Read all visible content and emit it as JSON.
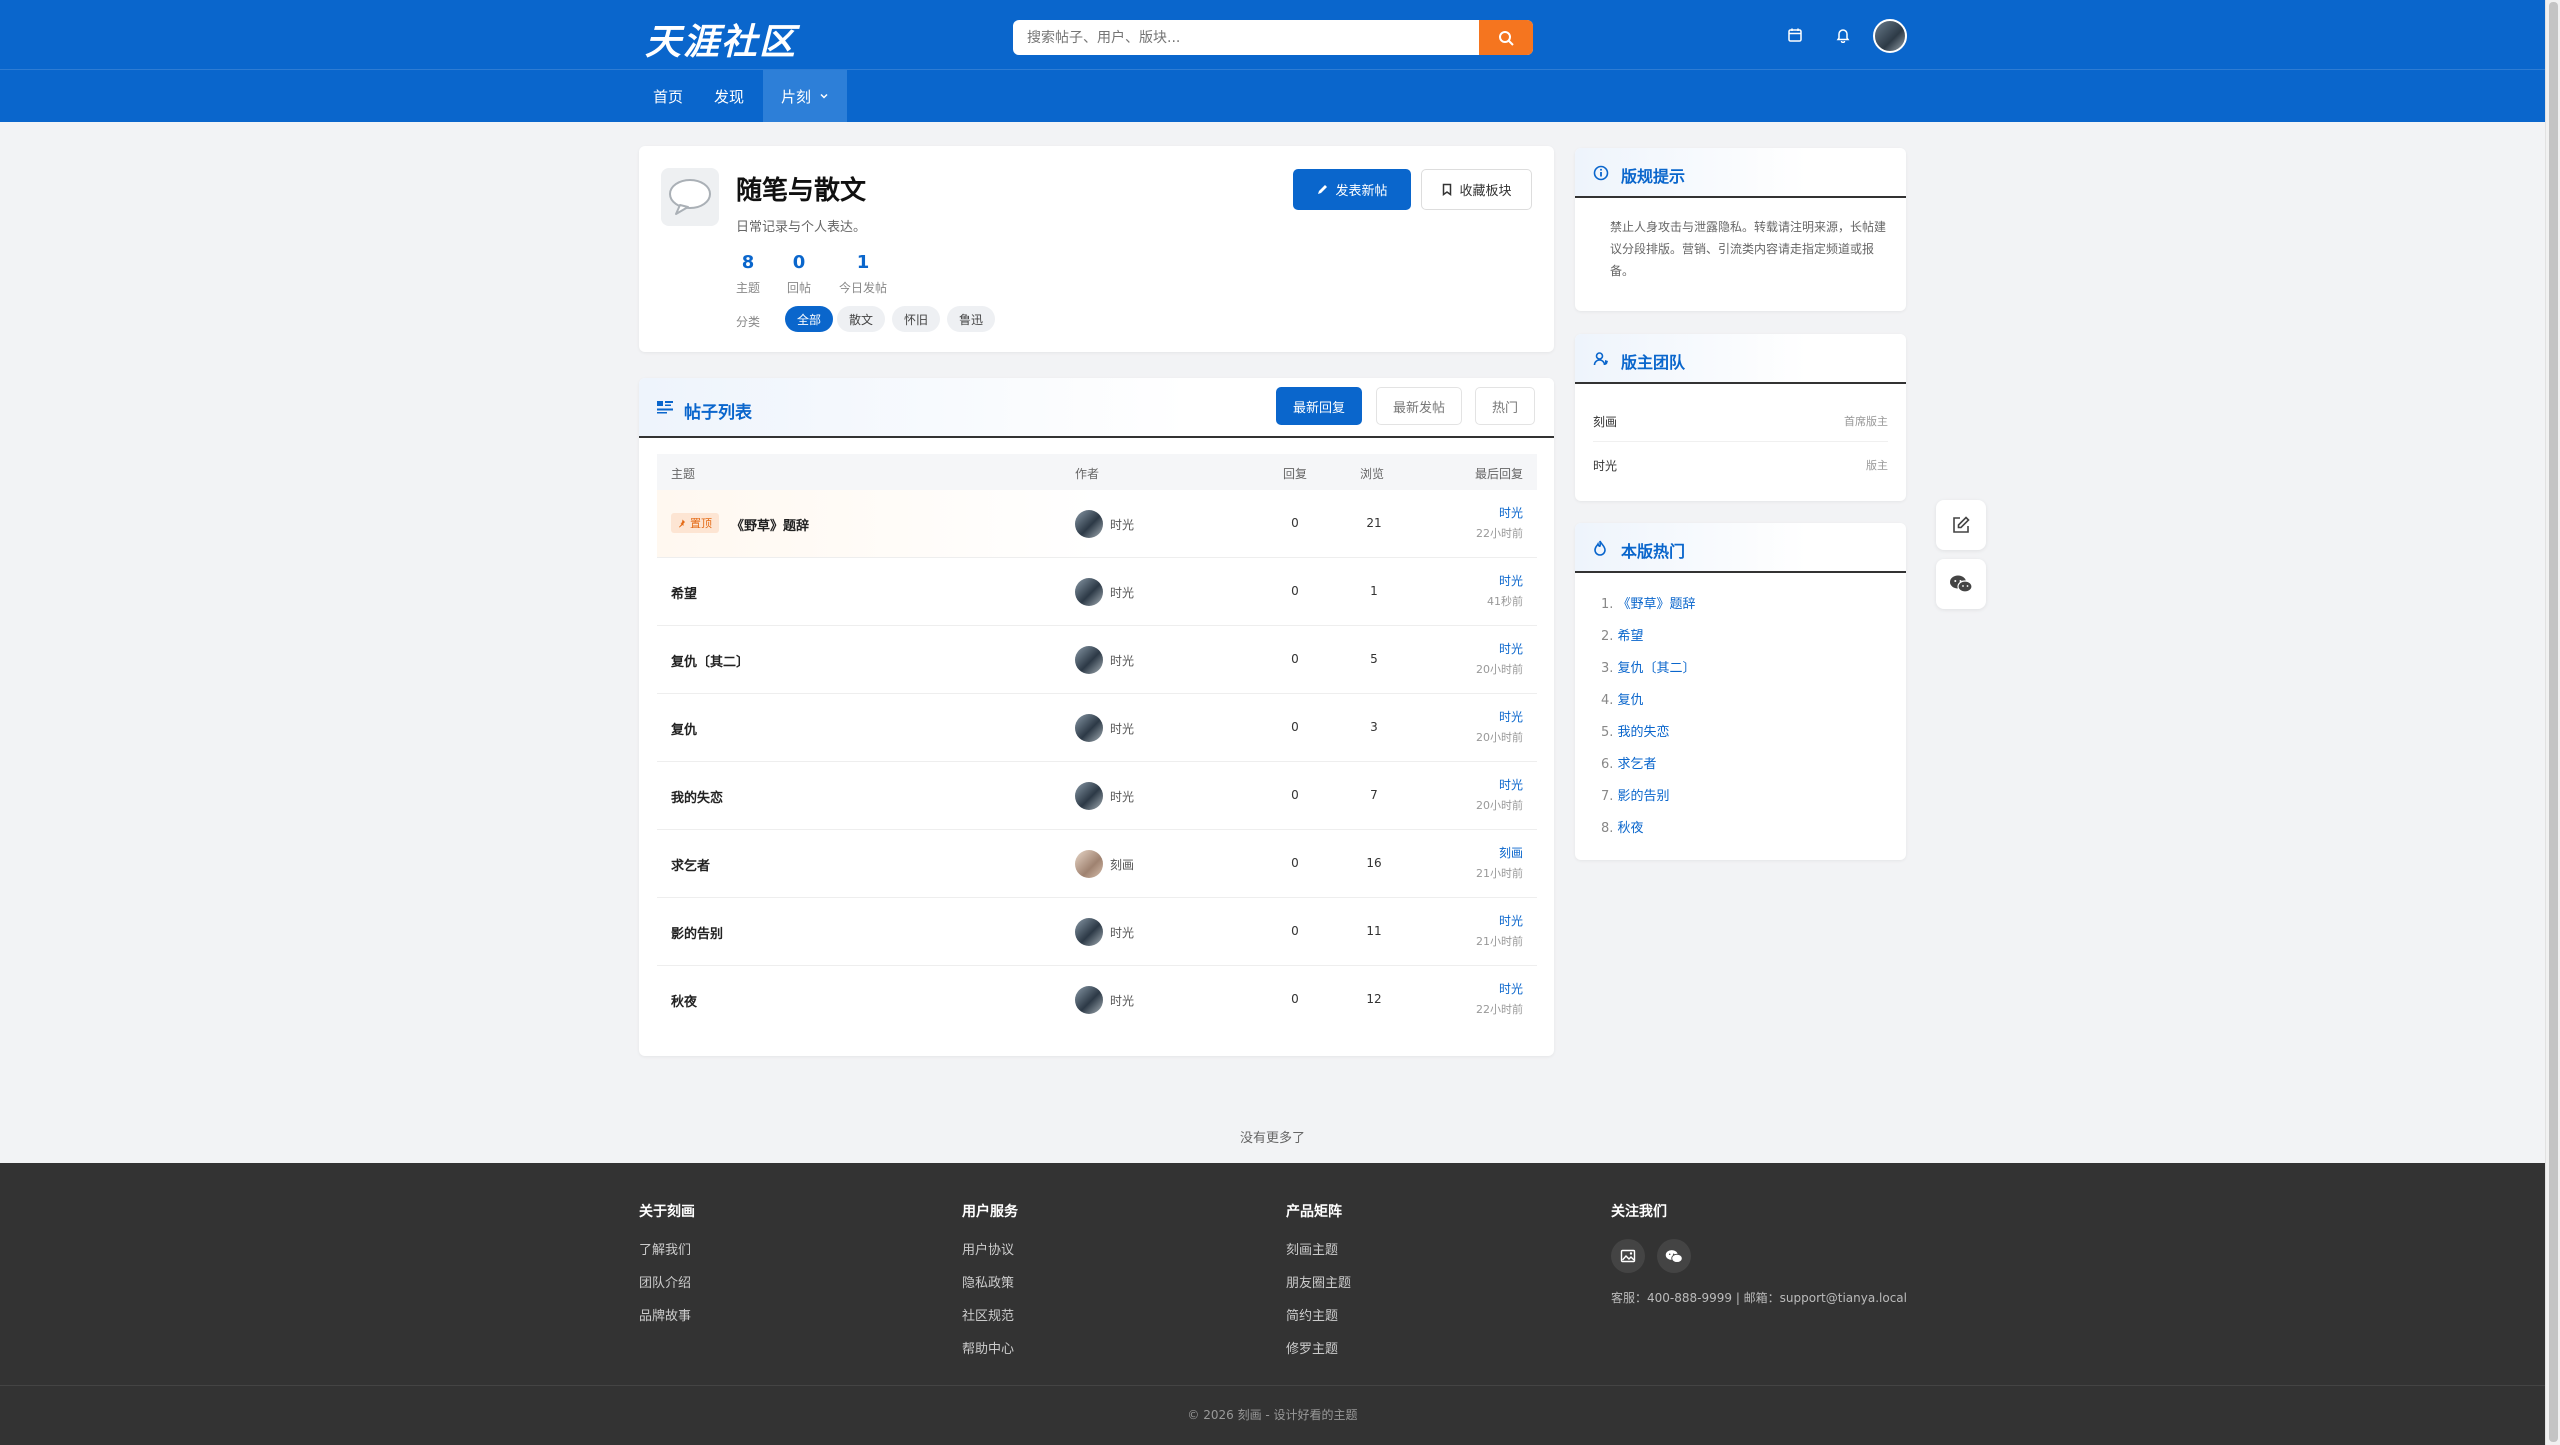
{
  "header": {
    "logo": "天涯社区",
    "search_placeholder": "搜索帖子、用户、版块...",
    "icons": [
      "calendar-icon",
      "bell-icon",
      "user-avatar"
    ]
  },
  "nav": {
    "items": [
      {
        "label": "首页"
      },
      {
        "label": "发现"
      },
      {
        "label": "片刻"
      }
    ]
  },
  "board": {
    "title": "随笔与散文",
    "desc": "日常记录与个人表达。",
    "stats": [
      {
        "num": "8",
        "label": "主题"
      },
      {
        "num": "0",
        "label": "回帖"
      },
      {
        "num": "1",
        "label": "今日发帖"
      }
    ],
    "category_label": "分类",
    "categories": [
      "全部",
      "散文",
      "怀旧",
      "鲁迅"
    ],
    "new_post": "发表新帖",
    "favorite": "收藏板块"
  },
  "posts": {
    "title": "帖子列表",
    "sort": [
      "最新回复",
      "最新发帖",
      "热门"
    ],
    "columns": {
      "subject": "主题",
      "author": "作者",
      "replies": "回复",
      "views": "浏览",
      "last": "最后回复"
    },
    "pin_label": "置顶",
    "rows": [
      {
        "subject": "《野草》题辞",
        "author": "时光",
        "replies": "0",
        "views": "21",
        "last_user": "时光",
        "last_time": "22小时前",
        "pinned": true
      },
      {
        "subject": "希望",
        "author": "时光",
        "replies": "0",
        "views": "1",
        "last_user": "时光",
        "last_time": "41秒前"
      },
      {
        "subject": "复仇〔其二〕",
        "author": "时光",
        "replies": "0",
        "views": "5",
        "last_user": "时光",
        "last_time": "20小时前"
      },
      {
        "subject": "复仇",
        "author": "时光",
        "replies": "0",
        "views": "3",
        "last_user": "时光",
        "last_time": "20小时前"
      },
      {
        "subject": "我的失恋",
        "author": "时光",
        "replies": "0",
        "views": "7",
        "last_user": "时光",
        "last_time": "20小时前"
      },
      {
        "subject": "求乞者",
        "author": "刻画",
        "replies": "0",
        "views": "16",
        "last_user": "刻画",
        "last_time": "21小时前"
      },
      {
        "subject": "影的告别",
        "author": "时光",
        "replies": "0",
        "views": "11",
        "last_user": "时光",
        "last_time": "21小时前"
      },
      {
        "subject": "秋夜",
        "author": "时光",
        "replies": "0",
        "views": "12",
        "last_user": "时光",
        "last_time": "22小时前"
      }
    ],
    "no_more": "没有更多了"
  },
  "sidebar": {
    "rules": {
      "title": "版规提示",
      "text": "禁止人身攻击与泄露隐私。转载请注明来源，长帖建议分段排版。营销、引流类内容请走指定频道或报备。"
    },
    "moderators": {
      "title": "版主团队",
      "list": [
        {
          "name": "刻画",
          "role": "首席版主"
        },
        {
          "name": "时光",
          "role": "版主"
        }
      ]
    },
    "hot": {
      "title": "本版热门",
      "list": [
        "《野草》题辞",
        "希望",
        "复仇〔其二〕",
        "复仇",
        "我的失恋",
        "求乞者",
        "影的告别",
        "秋夜"
      ]
    }
  },
  "footer": {
    "cols": [
      {
        "title": "关于刻画",
        "links": [
          "了解我们",
          "团队介绍",
          "品牌故事"
        ]
      },
      {
        "title": "用户服务",
        "links": [
          "用户协议",
          "隐私政策",
          "社区规范",
          "帮助中心"
        ]
      },
      {
        "title": "产品矩阵",
        "links": [
          "刻画主题",
          "朋友圈主题",
          "简约主题",
          "修罗主题"
        ]
      }
    ],
    "follow_title": "关注我们",
    "contact": "客服：400-888-9999 | 邮箱：support@tianya.local",
    "copyright": "© 2026 刻画 - 设计好看的主题"
  },
  "colors": {
    "brand": "#0a66cc",
    "search_button": "#f5751f",
    "footer_bg": "#333333"
  }
}
